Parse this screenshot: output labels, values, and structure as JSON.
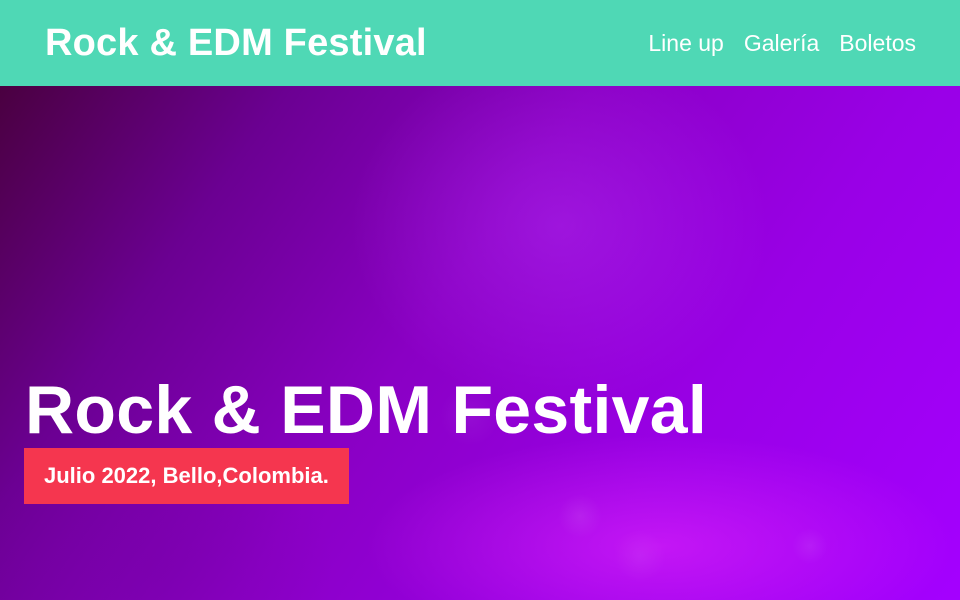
{
  "header": {
    "brand": "Rock & EDM Festival",
    "nav": [
      {
        "label": "Line up"
      },
      {
        "label": "Galería"
      },
      {
        "label": "Boletos"
      }
    ]
  },
  "hero": {
    "title": "Rock & EDM Festival",
    "subtitle": "Julio 2022, Bello,Colombia."
  },
  "colors": {
    "header_bg": "#4fd8b5",
    "hero_bg_start": "#4a0040",
    "hero_bg_end": "#a400ff",
    "badge_bg": "#f5364f",
    "text": "#ffffff"
  }
}
